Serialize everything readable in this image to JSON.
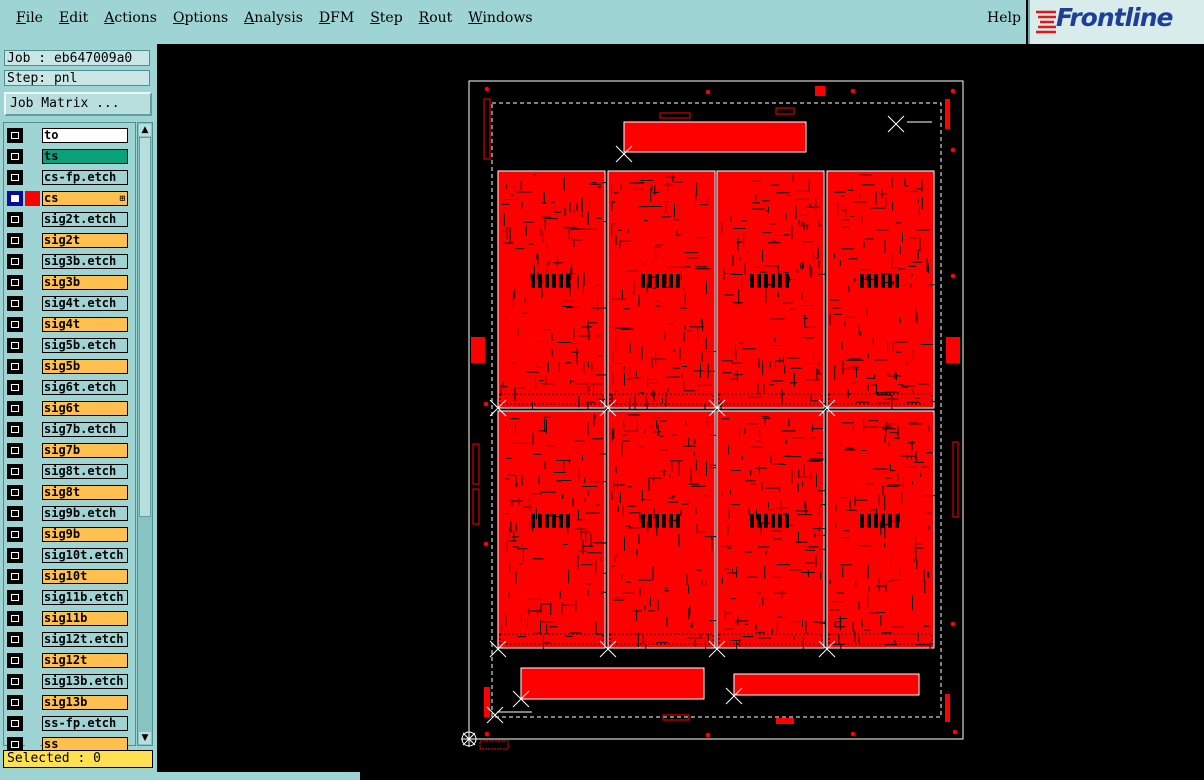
{
  "menu": {
    "items": [
      {
        "label": "File",
        "m": "F",
        "rest": "ile"
      },
      {
        "label": "Edit",
        "m": "E",
        "rest": "dit"
      },
      {
        "label": "Actions",
        "m": "A",
        "rest": "ctions"
      },
      {
        "label": "Options",
        "m": "O",
        "rest": "ptions"
      },
      {
        "label": "Analysis",
        "m": "A",
        "rest": "nalysis"
      },
      {
        "label": "DFM",
        "m": "D",
        "rest": "FM"
      },
      {
        "label": "Step",
        "m": "S",
        "rest": "tep"
      },
      {
        "label": "Rout",
        "m": "R",
        "rest": "out"
      },
      {
        "label": "Windows",
        "m": "W",
        "rest": "indows"
      }
    ],
    "help": "Help"
  },
  "logo": "Frontline",
  "job": "Job : eb647009a0",
  "step": "Step: pnl",
  "job_matrix": "Job Matrix ...",
  "layers": [
    {
      "name": "to",
      "color": "white"
    },
    {
      "name": "ts",
      "color": "green"
    },
    {
      "name": "cs-fp.etch",
      "color": "cyan"
    },
    {
      "name": "cs",
      "color": "orange",
      "selected": true
    },
    {
      "name": "sig2t.etch",
      "color": "cyan"
    },
    {
      "name": "sig2t",
      "color": "orange"
    },
    {
      "name": "sig3b.etch",
      "color": "cyan"
    },
    {
      "name": "sig3b",
      "color": "orange"
    },
    {
      "name": "sig4t.etch",
      "color": "cyan"
    },
    {
      "name": "sig4t",
      "color": "orange"
    },
    {
      "name": "sig5b.etch",
      "color": "cyan"
    },
    {
      "name": "sig5b",
      "color": "orange"
    },
    {
      "name": "sig6t.etch",
      "color": "cyan"
    },
    {
      "name": "sig6t",
      "color": "orange"
    },
    {
      "name": "sig7b.etch",
      "color": "cyan"
    },
    {
      "name": "sig7b",
      "color": "orange"
    },
    {
      "name": "sig8t.etch",
      "color": "cyan"
    },
    {
      "name": "sig8t",
      "color": "orange"
    },
    {
      "name": "sig9b.etch",
      "color": "cyan"
    },
    {
      "name": "sig9b",
      "color": "orange"
    },
    {
      "name": "sig10t.etch",
      "color": "cyan"
    },
    {
      "name": "sig10t",
      "color": "orange"
    },
    {
      "name": "sig11b.etch",
      "color": "cyan"
    },
    {
      "name": "sig11b",
      "color": "orange"
    },
    {
      "name": "sig12t.etch",
      "color": "cyan"
    },
    {
      "name": "sig12t",
      "color": "orange"
    },
    {
      "name": "sig13b.etch",
      "color": "cyan"
    },
    {
      "name": "sig13b",
      "color": "orange"
    },
    {
      "name": "ss-fp.etch",
      "color": "cyan"
    },
    {
      "name": "ss",
      "color": "orange"
    }
  ],
  "selected": "Selected : 0",
  "colors": {
    "board_red": "#ff0000",
    "panel_bg": "#9fd4d4"
  }
}
